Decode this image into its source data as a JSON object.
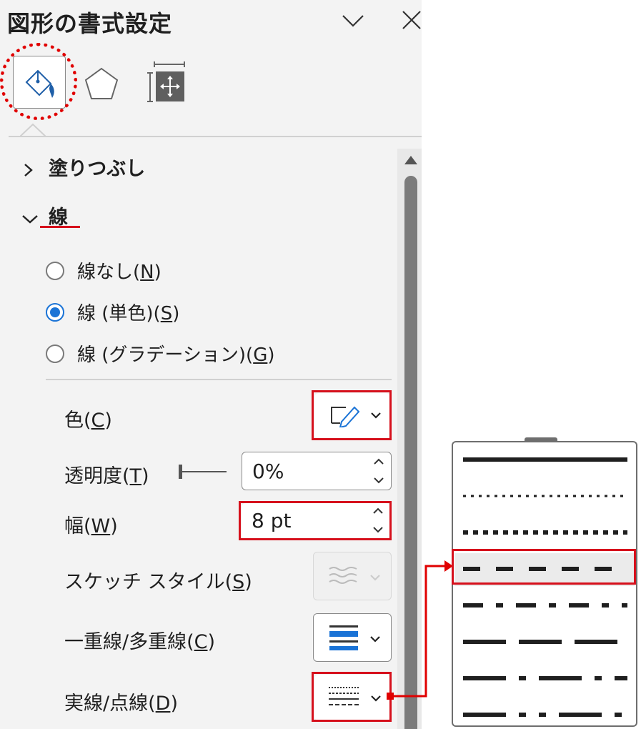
{
  "pane": {
    "title": "図形の書式設定",
    "tabs": [
      {
        "name": "fill-line-tab",
        "active": true
      },
      {
        "name": "effects-tab",
        "active": false
      },
      {
        "name": "size-properties-tab",
        "active": false
      }
    ]
  },
  "sections": {
    "fill": {
      "label": "塗りつぶし",
      "expanded": false
    },
    "line": {
      "label": "線",
      "expanded": true
    }
  },
  "line_options": [
    {
      "label": "線なし(",
      "key": "N",
      "suffix": ")",
      "selected": false
    },
    {
      "label": "線 (単色)(",
      "key": "S",
      "suffix": ")",
      "selected": true
    },
    {
      "label": "線 (グラデーション)(",
      "key": "G",
      "suffix": ")",
      "selected": false
    }
  ],
  "props": {
    "color": {
      "label": "色(",
      "key": "C",
      "suffix": ")"
    },
    "transparency": {
      "label": "透明度(",
      "key": "T",
      "suffix": ")",
      "value": "0%",
      "slider_value": 0
    },
    "width": {
      "label": "幅(",
      "key": "W",
      "suffix": ")",
      "value": "8 pt"
    },
    "sketch": {
      "label": "スケッチ スタイル(",
      "key": "S",
      "suffix": ")",
      "disabled": true
    },
    "compound": {
      "label": "一重線/多重線(",
      "key": "C",
      "suffix": ")"
    },
    "dash": {
      "label": "実線/点線(",
      "key": "D",
      "suffix": ")"
    }
  },
  "dash_menu": {
    "items": [
      "solid",
      "round-dot",
      "square-dot",
      "dash",
      "dash-dot",
      "long-dash",
      "long-dash-dot",
      "long-dash-dot-dot"
    ],
    "selected": "dash"
  },
  "colors": {
    "accent": "#1a73d6",
    "highlight": "#d6101c",
    "pane_bg": "#f3f3f3"
  }
}
